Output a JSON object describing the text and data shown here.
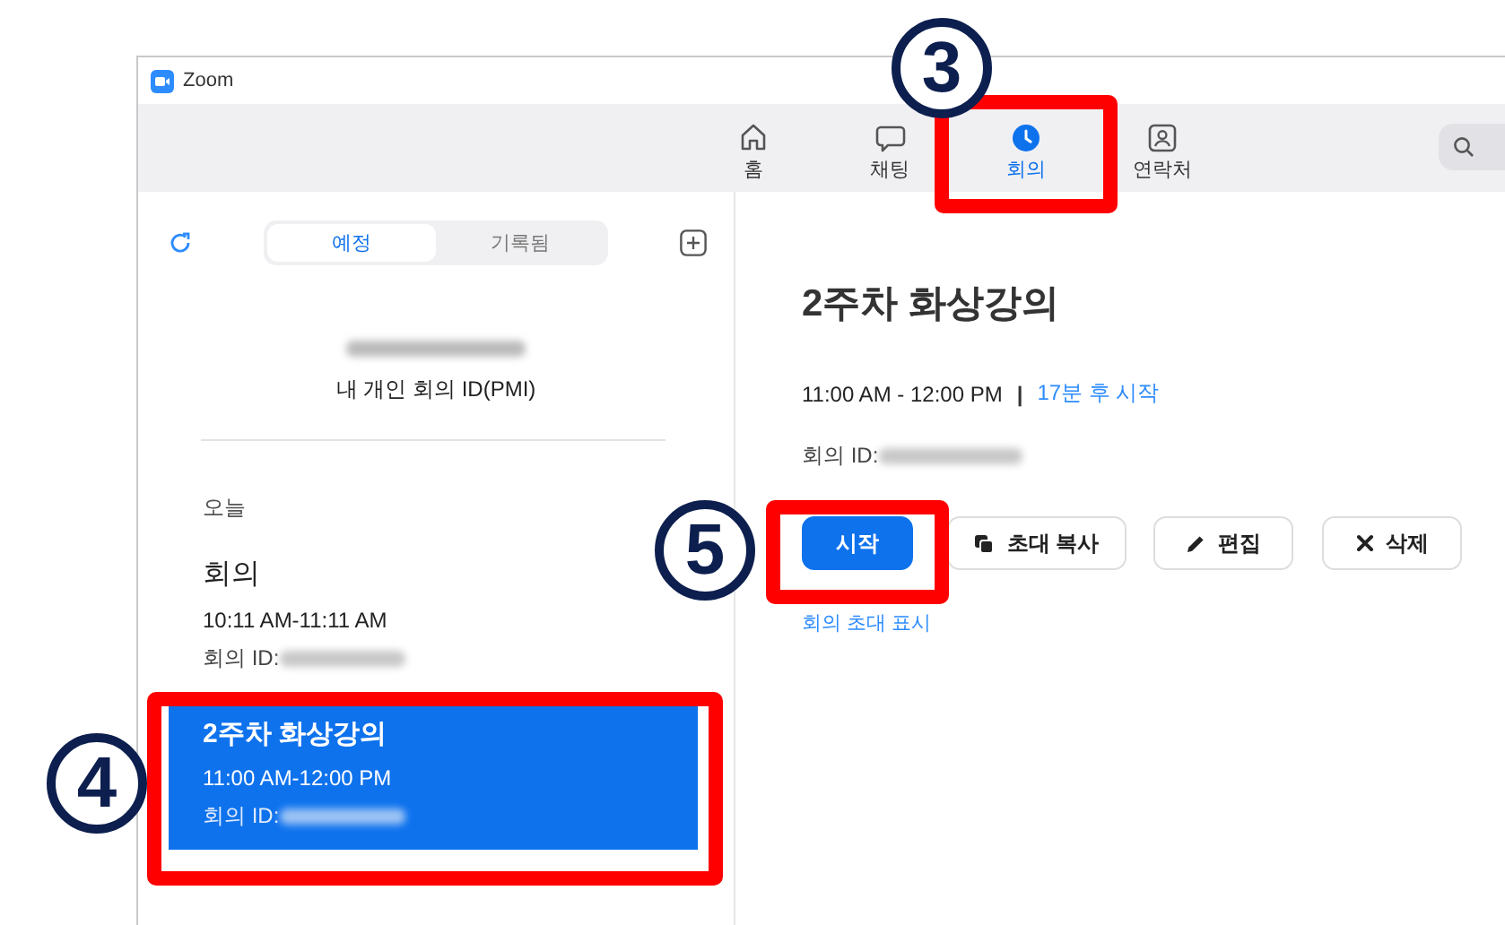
{
  "window": {
    "title": "Zoom"
  },
  "nav_tabs": [
    {
      "label": "홈",
      "kind": "home",
      "selected": false
    },
    {
      "label": "채팅",
      "kind": "chat",
      "selected": false
    },
    {
      "label": "회의",
      "kind": "meetings",
      "selected": true
    },
    {
      "label": "연락처",
      "kind": "contacts",
      "selected": false
    }
  ],
  "sidebar": {
    "segments": [
      {
        "label": "예정",
        "selected": true
      },
      {
        "label": "기록됨",
        "selected": false
      }
    ],
    "pmi_label": "내 개인 회의 ID(PMI)",
    "section": "오늘",
    "meetings": [
      {
        "title": "회의",
        "time": "10:11 AM-11:11 AM",
        "id_label": "회의 ID:",
        "selected": false
      },
      {
        "title": "2주차 화상강의",
        "time": "11:00 AM-12:00 PM",
        "id_label": "회의 ID:",
        "selected": true
      }
    ]
  },
  "detail": {
    "title": "2주차 화상강의",
    "time": "11:00 AM - 12:00 PM",
    "separator": "|",
    "starts_in": "17분 후 시작",
    "id_label": "회의 ID:",
    "buttons": [
      {
        "label": "시작",
        "kind": "primary"
      },
      {
        "label": "초대 복사",
        "kind": "copy"
      },
      {
        "label": "편집",
        "kind": "edit"
      },
      {
        "label": "삭제",
        "kind": "delete"
      }
    ],
    "invite_link": "회의 초대 표시"
  },
  "annotations": [
    {
      "number": "3"
    },
    {
      "number": "4"
    },
    {
      "number": "5"
    }
  ]
}
